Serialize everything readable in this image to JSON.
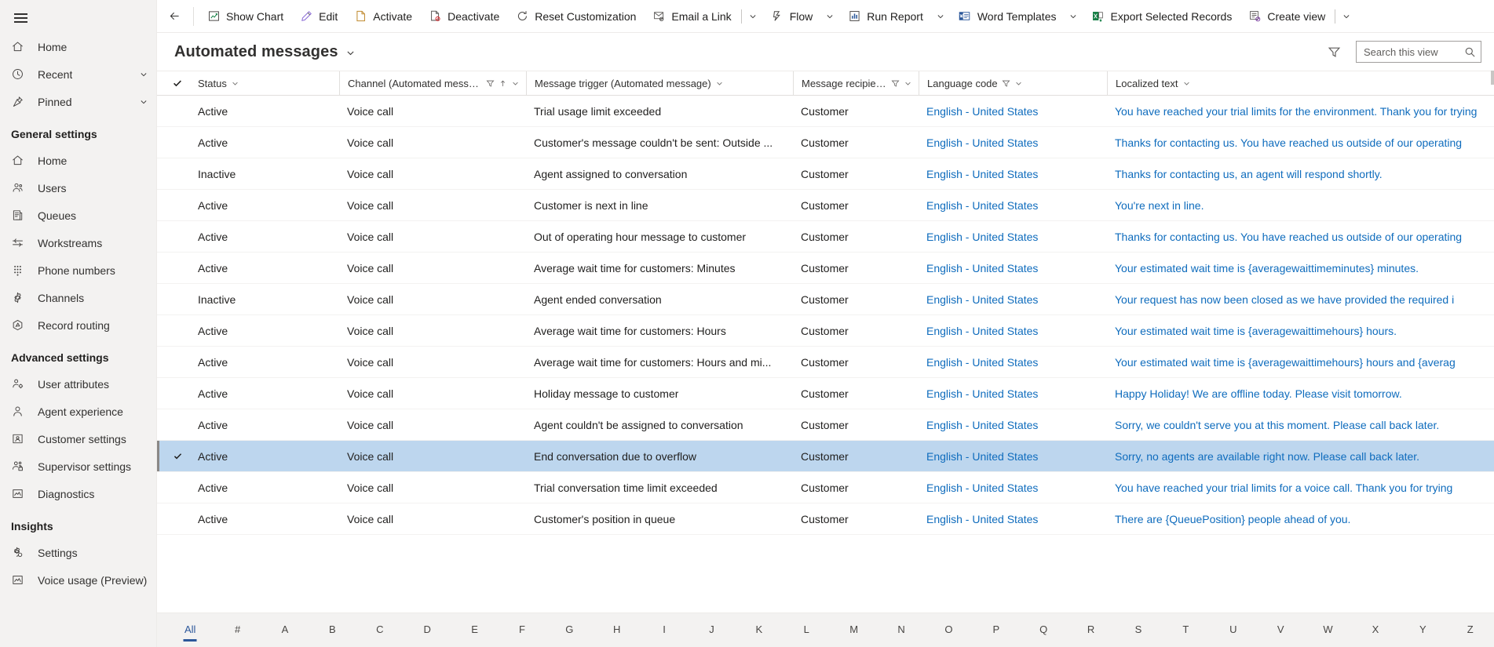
{
  "sidebar": {
    "hamburger_label": "Site map",
    "top_items": [
      {
        "label": "Home",
        "icon": "home-icon",
        "chevron": false
      },
      {
        "label": "Recent",
        "icon": "clock-icon",
        "chevron": true
      },
      {
        "label": "Pinned",
        "icon": "pin-icon",
        "chevron": true
      }
    ],
    "groups": [
      {
        "title": "General settings",
        "items": [
          {
            "label": "Home",
            "icon": "home-icon"
          },
          {
            "label": "Users",
            "icon": "users-icon"
          },
          {
            "label": "Queues",
            "icon": "queues-icon"
          },
          {
            "label": "Workstreams",
            "icon": "workstreams-icon"
          },
          {
            "label": "Phone numbers",
            "icon": "dialpad-icon"
          },
          {
            "label": "Channels",
            "icon": "gear-icon"
          },
          {
            "label": "Record routing",
            "icon": "route-icon"
          }
        ]
      },
      {
        "title": "Advanced settings",
        "items": [
          {
            "label": "User attributes",
            "icon": "user-attributes-icon"
          },
          {
            "label": "Agent experience",
            "icon": "agent-icon"
          },
          {
            "label": "Customer settings",
            "icon": "customer-card-icon"
          },
          {
            "label": "Supervisor settings",
            "icon": "supervisor-icon"
          },
          {
            "label": "Diagnostics",
            "icon": "diagnostics-icon"
          }
        ]
      },
      {
        "title": "Insights",
        "items": [
          {
            "label": "Settings",
            "icon": "insights-gear-icon"
          },
          {
            "label": "Voice usage (Preview)",
            "icon": "chart-icon"
          }
        ]
      }
    ]
  },
  "commandbar": {
    "back_label": "Back",
    "buttons": [
      {
        "label": "Show Chart",
        "icon": "show-chart-icon",
        "chevron": false,
        "divider_before": false
      },
      {
        "label": "Edit",
        "icon": "edit-pencil-icon",
        "chevron": false,
        "divider_before": false
      },
      {
        "label": "Activate",
        "icon": "activate-icon",
        "chevron": false,
        "divider_before": false
      },
      {
        "label": "Deactivate",
        "icon": "deactivate-icon",
        "chevron": false,
        "divider_before": false
      },
      {
        "label": "Reset Customization",
        "icon": "reset-icon",
        "chevron": false,
        "divider_before": false
      },
      {
        "label": "Email a Link",
        "icon": "email-link-icon",
        "chevron": true,
        "divider_before": false,
        "vsep_before_chevron": true
      },
      {
        "label": "Flow",
        "icon": "flow-icon",
        "chevron": true,
        "divider_before": false
      },
      {
        "label": "Run Report",
        "icon": "run-report-icon",
        "chevron": true,
        "divider_before": false
      },
      {
        "label": "Word Templates",
        "icon": "word-templates-icon",
        "chevron": true,
        "divider_before": false
      },
      {
        "label": "Export Selected Records",
        "icon": "excel-export-icon",
        "chevron": false,
        "divider_before": false
      },
      {
        "label": "Create view",
        "icon": "create-view-icon",
        "chevron": true,
        "divider_before": false,
        "vsep_before_chevron": true
      }
    ]
  },
  "view": {
    "title": "Automated messages",
    "title_chevron": "chevron-down-icon",
    "filter_icon": "filter-icon",
    "search": {
      "placeholder": "Search this view",
      "value": "",
      "icon": "search-icon"
    }
  },
  "grid": {
    "columns": [
      {
        "label": "Status",
        "key": "status",
        "filter": false,
        "sort": false,
        "chevron": true
      },
      {
        "label": "Channel (Automated message)",
        "key": "channel",
        "filter": true,
        "sort": true,
        "chevron": true
      },
      {
        "label": "Message trigger (Automated message)",
        "key": "trigger",
        "filter": false,
        "sort": false,
        "chevron": true
      },
      {
        "label": "Message recipient (...",
        "key": "recipient",
        "filter": true,
        "sort": false,
        "chevron": true
      },
      {
        "label": "Language code",
        "key": "language",
        "filter": true,
        "sort": false,
        "chevron": true
      },
      {
        "label": "Localized text",
        "key": "localized",
        "filter": false,
        "sort": false,
        "chevron": true
      }
    ],
    "rows": [
      {
        "status": "Active",
        "channel": "Voice call",
        "trigger": "Trial usage limit exceeded",
        "recipient": "Customer",
        "language": "English - United States",
        "localized": "You have reached your trial limits for the environment. Thank you for trying",
        "selected": false
      },
      {
        "status": "Active",
        "channel": "Voice call",
        "trigger": "Customer's message couldn't be sent: Outside ...",
        "recipient": "Customer",
        "language": "English - United States",
        "localized": "Thanks for contacting us. You have reached us outside of our operating",
        "selected": false
      },
      {
        "status": "Inactive",
        "channel": "Voice call",
        "trigger": "Agent assigned to conversation",
        "recipient": "Customer",
        "language": "English - United States",
        "localized": "Thanks for contacting us, an agent will respond shortly.",
        "selected": false
      },
      {
        "status": "Active",
        "channel": "Voice call",
        "trigger": "Customer is next in line",
        "recipient": "Customer",
        "language": "English - United States",
        "localized": "You're next in line.",
        "selected": false
      },
      {
        "status": "Active",
        "channel": "Voice call",
        "trigger": "Out of operating hour message to customer",
        "recipient": "Customer",
        "language": "English - United States",
        "localized": "Thanks for contacting us. You have reached us outside of our operating",
        "selected": false
      },
      {
        "status": "Active",
        "channel": "Voice call",
        "trigger": "Average wait time for customers: Minutes",
        "recipient": "Customer",
        "language": "English - United States",
        "localized": "Your estimated wait time is {averagewaittimeminutes} minutes.",
        "selected": false
      },
      {
        "status": "Inactive",
        "channel": "Voice call",
        "trigger": "Agent ended conversation",
        "recipient": "Customer",
        "language": "English - United States",
        "localized": "Your request has now been closed as we have provided the required i",
        "selected": false
      },
      {
        "status": "Active",
        "channel": "Voice call",
        "trigger": "Average wait time for customers: Hours",
        "recipient": "Customer",
        "language": "English - United States",
        "localized": "Your estimated wait time is {averagewaittimehours} hours.",
        "selected": false
      },
      {
        "status": "Active",
        "channel": "Voice call",
        "trigger": "Average wait time for customers: Hours and mi...",
        "recipient": "Customer",
        "language": "English - United States",
        "localized": "Your estimated wait time is {averagewaittimehours} hours and {averag",
        "selected": false
      },
      {
        "status": "Active",
        "channel": "Voice call",
        "trigger": "Holiday message to customer",
        "recipient": "Customer",
        "language": "English - United States",
        "localized": "Happy Holiday! We are offline today. Please visit tomorrow.",
        "selected": false
      },
      {
        "status": "Active",
        "channel": "Voice call",
        "trigger": "Agent couldn't be assigned to conversation",
        "recipient": "Customer",
        "language": "English - United States",
        "localized": "Sorry, we couldn't serve you at this moment. Please call back later.",
        "selected": false
      },
      {
        "status": "Active",
        "channel": "Voice call",
        "trigger": "End conversation due to overflow",
        "recipient": "Customer",
        "language": "English - United States",
        "localized": "Sorry, no agents are available right now. Please call back later.",
        "selected": true
      },
      {
        "status": "Active",
        "channel": "Voice call",
        "trigger": "Trial conversation time limit exceeded",
        "recipient": "Customer",
        "language": "English - United States",
        "localized": "You have reached your trial limits for a voice call. Thank you for trying",
        "selected": false
      },
      {
        "status": "Active",
        "channel": "Voice call",
        "trigger": "Customer's position in queue",
        "recipient": "Customer",
        "language": "English - United States",
        "localized": "There are {QueuePosition} people ahead of you.",
        "selected": false
      }
    ]
  },
  "alphabar": {
    "active": "All",
    "items": [
      "All",
      "#",
      "A",
      "B",
      "C",
      "D",
      "E",
      "F",
      "G",
      "H",
      "I",
      "J",
      "K",
      "L",
      "M",
      "N",
      "O",
      "P",
      "Q",
      "R",
      "S",
      "T",
      "U",
      "V",
      "W",
      "X",
      "Y",
      "Z"
    ]
  },
  "colors": {
    "accent": "#0f6cbd",
    "selected_row": "#bdd6ee",
    "sidebar_bg": "#f3f2f1",
    "active_alpha": "#2b579a"
  }
}
